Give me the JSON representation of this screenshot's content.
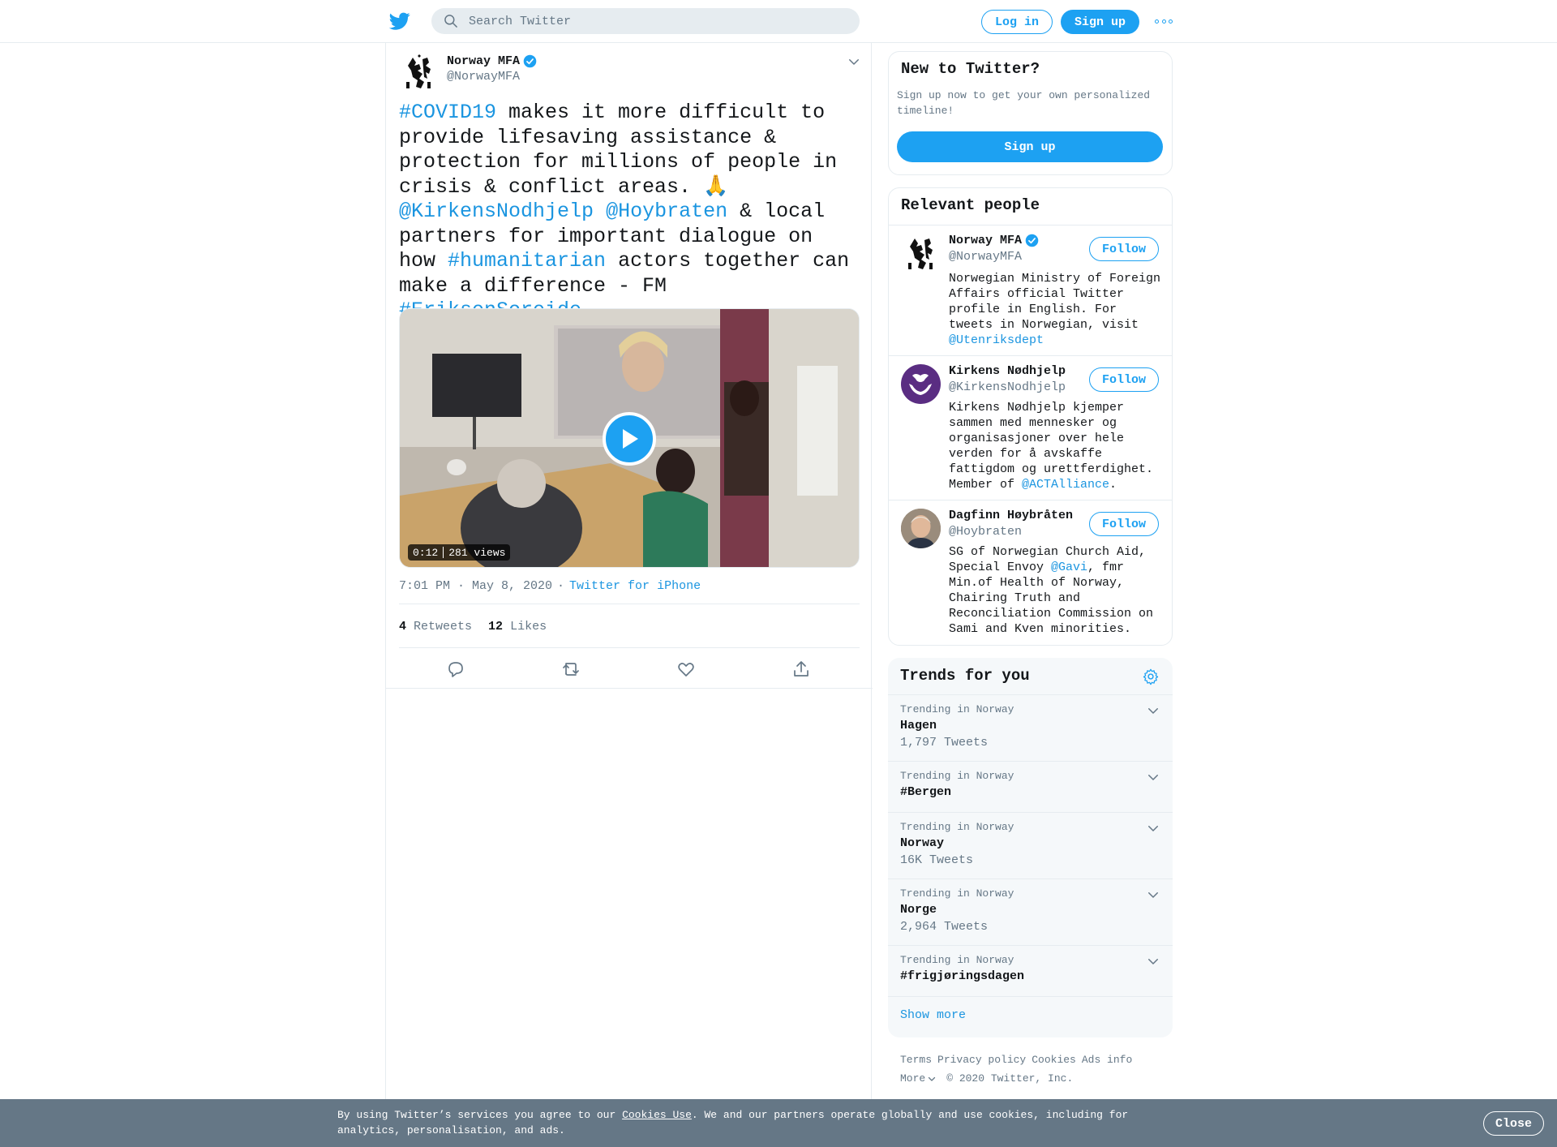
{
  "header": {
    "search_placeholder": "Search Twitter",
    "login_label": "Log in",
    "signup_label": "Sign up"
  },
  "tweet": {
    "author_name": "Norway MFA",
    "author_handle": "@NorwayMFA",
    "text_segments": [
      {
        "text": "#COVID19",
        "link": true
      },
      {
        "text": " makes it more difficult to provide lifesaving assistance & protection for millions of people in crisis & conflict areas. 🙏 ",
        "link": false
      },
      {
        "text": "@KirkensNodhjelp",
        "link": true
      },
      {
        "text": " ",
        "link": false
      },
      {
        "text": "@Hoybraten",
        "link": true
      },
      {
        "text": " & local partners for important dialogue on how ",
        "link": false
      },
      {
        "text": "#humanitarian",
        "link": true
      },
      {
        "text": " actors together can make a difference - FM ",
        "link": false
      },
      {
        "text": "#EriksenSoreide",
        "link": true
      }
    ],
    "video_duration": "0:12",
    "video_views": "281 views",
    "time": "7:01 PM · May 8, 2020",
    "separator": "·",
    "source": "Twitter for iPhone",
    "retweets_count": "4",
    "retweets_label": "Retweets",
    "likes_count": "12",
    "likes_label": "Likes"
  },
  "new_to_twitter": {
    "title": "New to Twitter?",
    "subtitle": "Sign up now to get your own personalized timeline!",
    "signup_label": "Sign up"
  },
  "relevant_people": {
    "title": "Relevant people",
    "follow_label": "Follow",
    "people": [
      {
        "name": "Norway MFA",
        "verified": true,
        "handle": "@NorwayMFA",
        "bio_before": "Norwegian Ministry of Foreign Affairs official Twitter profile in English. For tweets in Norwegian, visit ",
        "bio_link": "@Utenriksdept",
        "bio_after": ""
      },
      {
        "name": "Kirkens Nødhjelp",
        "verified": false,
        "handle": "@KirkensNodhjelp",
        "bio_before": "Kirkens Nødhjelp kjemper sammen med mennesker og organisasjoner over hele verden for å avskaffe fattigdom og urettferdighet. Member of ",
        "bio_link": "@ACTAlliance",
        "bio_after": "."
      },
      {
        "name": "Dagfinn Høybråten",
        "verified": false,
        "handle": "@Hoybraten",
        "bio_before": "SG of Norwegian Church Aid, Special Envoy ",
        "bio_link": "@Gavi",
        "bio_after": ", fmr Min.of Health of Norway, Chairing Truth and Reconciliation Commission on Sami and Kven minorities."
      }
    ]
  },
  "trends": {
    "title": "Trends for you",
    "items": [
      {
        "context": "Trending in Norway",
        "name": "Hagen",
        "count": "1,797 Tweets"
      },
      {
        "context": "Trending in Norway",
        "name": "#Bergen",
        "count": ""
      },
      {
        "context": "Trending in Norway",
        "name": "Norway",
        "count": "16K Tweets"
      },
      {
        "context": "Trending in Norway",
        "name": "Norge",
        "count": "2,964 Tweets"
      },
      {
        "context": "Trending in Norway",
        "name": "#frigjøringsdagen",
        "count": ""
      }
    ],
    "show_more": "Show more"
  },
  "footer": {
    "links": [
      "Terms",
      "Privacy policy",
      "Cookies",
      "Ads info"
    ],
    "more_label": "More",
    "copyright": "© 2020 Twitter, Inc."
  },
  "cookie_bar": {
    "text_before": "By using Twitter’s services you agree to our ",
    "link": "Cookies Use",
    "text_after": ". We and our partners operate globally and use cookies, including for analytics, personalisation, and ads.",
    "close_label": "Close"
  },
  "colors": {
    "accent": "#1da1f2",
    "link": "#1b95e0",
    "muted": "#657786",
    "cookie_bar": "#657786"
  },
  "icons": [
    "twitter-bird-icon",
    "search-icon",
    "more-dots-icon",
    "verified-icon",
    "chevron-down-icon",
    "play-icon",
    "reply-icon",
    "retweet-icon",
    "like-icon",
    "share-icon",
    "settings-gear-icon"
  ]
}
